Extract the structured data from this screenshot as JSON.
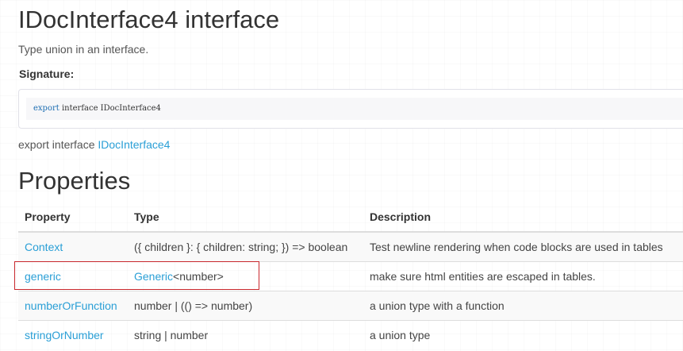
{
  "page": {
    "title": "IDocInterface4 interface",
    "summary": "Type union in an interface.",
    "signature_label": "Signature:",
    "signature_code": {
      "keyword": "export",
      "rest": " interface IDocInterface4"
    },
    "heritage": {
      "prefix": "export interface ",
      "link": "IDocInterface4"
    },
    "properties_heading": "Properties"
  },
  "table": {
    "headers": [
      "Property",
      "Type",
      "Description"
    ],
    "rows": [
      {
        "property": "Context",
        "type_link": "",
        "type_text": "({ children }: { children: string; }) => boolean",
        "description": "Test newline rendering when code blocks are used in tables"
      },
      {
        "property": "generic",
        "type_link": "Generic",
        "type_text": "<number>",
        "description": "make sure html entities are escaped in tables."
      },
      {
        "property": "numberOrFunction",
        "type_link": "",
        "type_text": "number | (() => number)",
        "description": "a union type with a function"
      },
      {
        "property": "stringOrNumber",
        "type_link": "",
        "type_text": "string | number",
        "description": "a union type"
      }
    ]
  },
  "colors": {
    "link": "#2a9fd6",
    "highlight_border": "#c8272c",
    "code_keyword": "#1f6fb3"
  }
}
